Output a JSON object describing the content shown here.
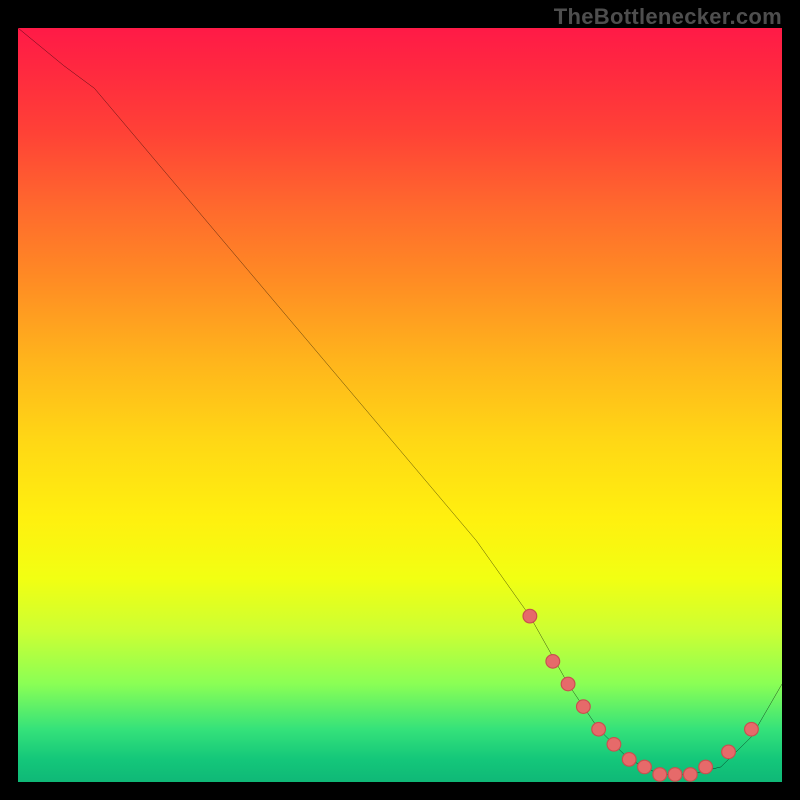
{
  "watermark": "TheBottlenecker.com",
  "colors": {
    "background": "#000000",
    "watermark": "#4e4e4e",
    "curve": "#000000",
    "marker_fill": "#e66a6a",
    "marker_stroke": "#c94f4f"
  },
  "chart_data": {
    "type": "line",
    "title": "",
    "xlabel": "",
    "ylabel": "",
    "xlim": [
      0,
      100
    ],
    "ylim": [
      0,
      100
    ],
    "series": [
      {
        "name": "bottleneck-curve",
        "x": [
          0,
          6,
          10,
          20,
          30,
          40,
          50,
          60,
          67,
          72,
          76,
          80,
          84,
          88,
          92,
          96,
          100
        ],
        "y": [
          100,
          95,
          92,
          80,
          68,
          56,
          44,
          32,
          22,
          13,
          7,
          3,
          1,
          1,
          2,
          6,
          13
        ]
      }
    ],
    "markers": {
      "name": "highlight-points",
      "x": [
        67,
        70,
        72,
        74,
        76,
        78,
        80,
        82,
        84,
        86,
        88,
        90,
        93,
        96
      ],
      "y": [
        22,
        16,
        13,
        10,
        7,
        5,
        3,
        2,
        1,
        1,
        1,
        2,
        4,
        7
      ]
    },
    "background_gradient": {
      "direction": "vertical",
      "stops": [
        {
          "pos": 0.0,
          "color": "#ff1a47"
        },
        {
          "pos": 0.33,
          "color": "#ff8a24"
        },
        {
          "pos": 0.65,
          "color": "#fff00f"
        },
        {
          "pos": 0.87,
          "color": "#8aff55"
        },
        {
          "pos": 1.0,
          "color": "#0fb877"
        }
      ]
    }
  }
}
